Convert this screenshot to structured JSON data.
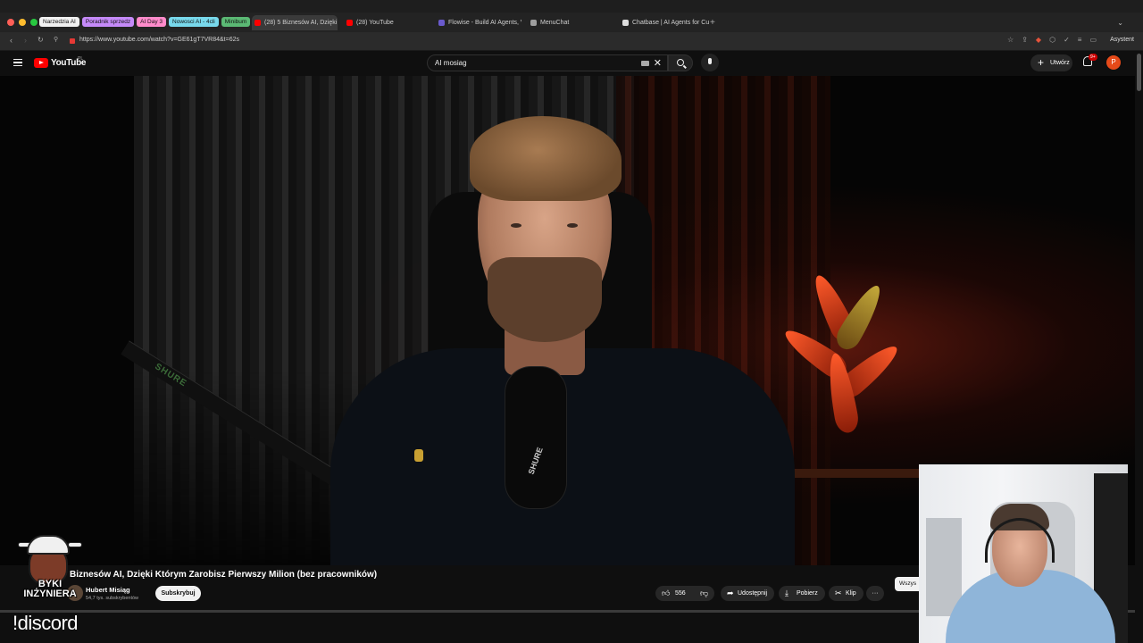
{
  "browser": {
    "tab_groups": [
      {
        "label": "Narzedzia AI",
        "color": "#f1f1f1"
      },
      {
        "label": "Poradnik sprzedz",
        "color": "#c58af9"
      },
      {
        "label": "AI Day 3",
        "color": "#ff8bcb"
      },
      {
        "label": "Nowosci AI - 4cli",
        "color": "#78d9ec"
      },
      {
        "label": "Minibum",
        "color": "#5bb974"
      }
    ],
    "tabs": [
      {
        "label": "(28) 5 Biznesów AI, Dzięki K",
        "active": true,
        "favicon_color": "#ff0000"
      },
      {
        "label": "(28) YouTube",
        "active": false,
        "favicon_color": "#ff0000"
      },
      {
        "label": "Flowise - Build AI Agents, V",
        "active": false,
        "favicon_color": "#6a5acd"
      },
      {
        "label": "MenuChat",
        "active": false,
        "favicon_color": "#9e9e9e"
      },
      {
        "label": "Chatbase | AI Agents for Cu",
        "active": false,
        "favicon_color": "#dddddd"
      }
    ],
    "new_tab_label": "+",
    "url": "https://www.youtube.com/watch?v=GE61gT7VR84&t=62s",
    "assistant_label": "Asystent"
  },
  "youtube": {
    "logo_text": "YouTube",
    "region_code": "PL",
    "search_value": "AI mosiag",
    "create_label": "Utwórz",
    "notifications_badge": "9+",
    "avatar_letter": "P",
    "mic_brand": "SHURE"
  },
  "video": {
    "title": "Biznesów AI, Dzięki Którym Zarobisz Pierwszy Milion (bez pracowników)",
    "channel_name": "Hubert Misiąg",
    "subscribers": "54,7 tys. subskrybentów",
    "subscribe_label": "Subskrybuj",
    "likes": "556",
    "share_label": "Udostępnij",
    "download_label": "Pobierz",
    "clip_label": "Klip",
    "more_label": "···",
    "filter_chip_label": "Wszys",
    "progress_fraction": 0.0
  },
  "overlay": {
    "brand_logo_text": "BYKI INŻYNIERA",
    "chat_command": "!discord"
  }
}
